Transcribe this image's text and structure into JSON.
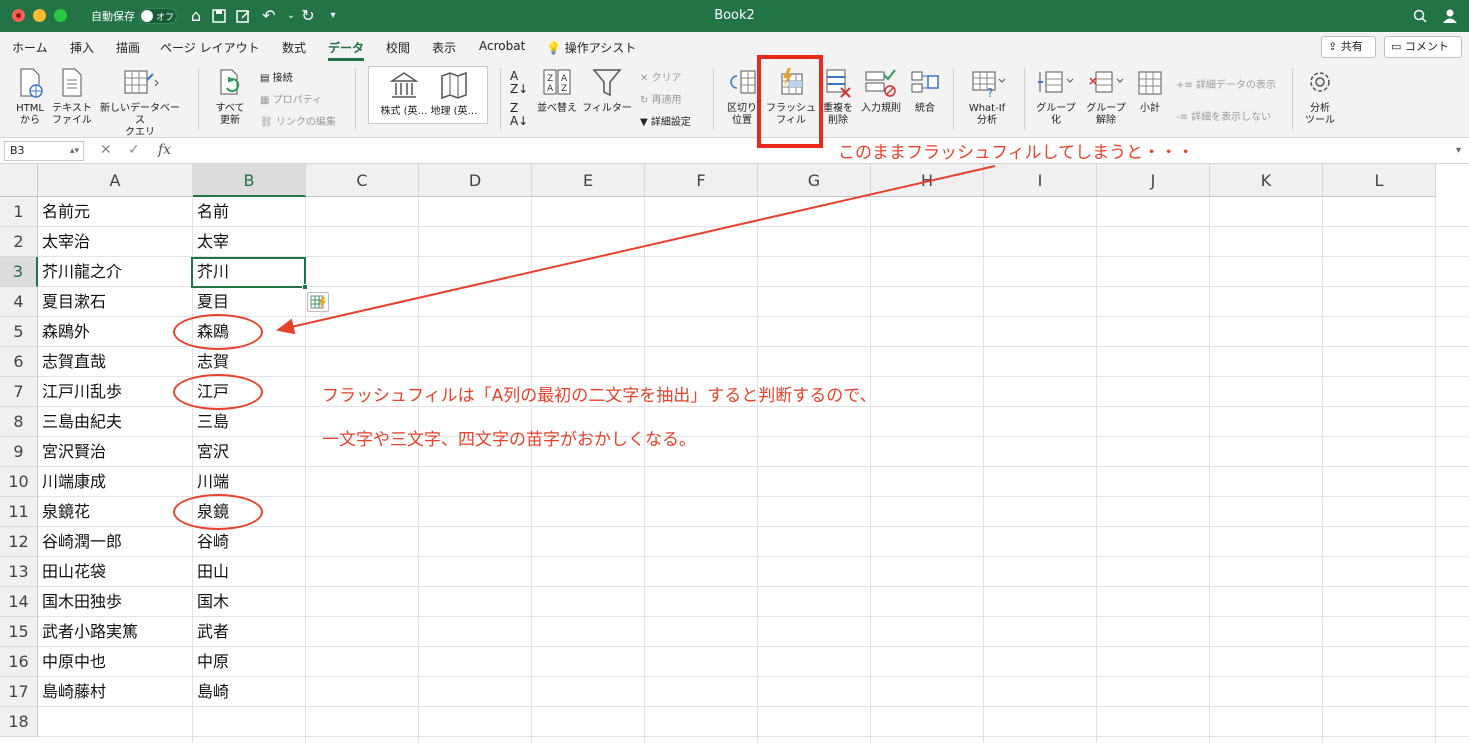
{
  "titlebar": {
    "autosave_label": "自動保存",
    "autosave_state": "オフ",
    "doc_title": "Book2",
    "bg_color": "#227346"
  },
  "tabs": [
    "ホーム",
    "挿入",
    "描画",
    "ページ レイアウト",
    "数式",
    "データ",
    "校閲",
    "表示",
    "Acrobat",
    "操作アシスト"
  ],
  "active_tab": "データ",
  "share_label": "共有",
  "comment_label": "コメント",
  "ribbon": {
    "html_from": "HTML\nから",
    "text_file": "テキスト\nファイル",
    "new_query": "新しいデータベース\nクエリ",
    "refresh_all": "すべて\n更新",
    "connections": "接続",
    "properties": "プロパティ",
    "edit_links": "リンクの編集",
    "stocks": "株式 (英…",
    "geography": "地理 (英…",
    "sort": "並べ替え",
    "filter": "フィルター",
    "clear": "クリア",
    "reapply": "再適用",
    "advanced": "詳細設定",
    "text_to_columns": "区切り\n位置",
    "flash_fill": "フラッシュ\nフィル",
    "remove_duplicates": "重複を\n削除",
    "data_validation": "入力規則",
    "consolidate": "統合",
    "what_if": "What-If\n分析",
    "group": "グループ\n化",
    "ungroup": "グループ\n解除",
    "subtotal": "小計",
    "show_detail": "詳細データの表示",
    "hide_detail": "詳細を表示しない",
    "analysis_tools": "分析\nツール"
  },
  "name_box": "B3",
  "formula_content": "",
  "columns": [
    "A",
    "B",
    "C",
    "D",
    "E",
    "F",
    "G",
    "H",
    "I",
    "J",
    "K",
    "L"
  ],
  "selected_cell": {
    "col": "B",
    "row": 3
  },
  "rows": [
    {
      "num": "1",
      "a": "名前元",
      "b": "名前"
    },
    {
      "num": "2",
      "a": "太宰治",
      "b": "太宰"
    },
    {
      "num": "3",
      "a": "芥川龍之介",
      "b": "芥川"
    },
    {
      "num": "4",
      "a": "夏目漱石",
      "b": "夏目"
    },
    {
      "num": "5",
      "a": "森鴎外",
      "b": "森鴎"
    },
    {
      "num": "6",
      "a": "志賀直哉",
      "b": "志賀"
    },
    {
      "num": "7",
      "a": "江戸川乱歩",
      "b": "江戸"
    },
    {
      "num": "8",
      "a": "三島由紀夫",
      "b": "三島"
    },
    {
      "num": "9",
      "a": "宮沢賢治",
      "b": "宮沢"
    },
    {
      "num": "10",
      "a": "川端康成",
      "b": "川端"
    },
    {
      "num": "11",
      "a": "泉鏡花",
      "b": "泉鏡"
    },
    {
      "num": "12",
      "a": "谷崎潤一郎",
      "b": "谷崎"
    },
    {
      "num": "13",
      "a": "田山花袋",
      "b": "田山"
    },
    {
      "num": "14",
      "a": "国木田独歩",
      "b": "国木"
    },
    {
      "num": "15",
      "a": "武者小路実篤",
      "b": "武者"
    },
    {
      "num": "16",
      "a": "中原中也",
      "b": "中原"
    },
    {
      "num": "17",
      "a": "島崎藤村",
      "b": "島崎"
    },
    {
      "num": "18",
      "a": "",
      "b": ""
    }
  ],
  "annotations": {
    "callout": "このままフラッシュフィルしてしまうと・・・",
    "explanation_line1": "フラッシュフィルは「A列の最初の二文字を抽出」すると判断するので、",
    "explanation_line2": "一文字や三文字、四文字の苗字がおかしくなる。",
    "color": "#e8412c",
    "circled_rows": [
      "5",
      "7",
      "11"
    ]
  }
}
